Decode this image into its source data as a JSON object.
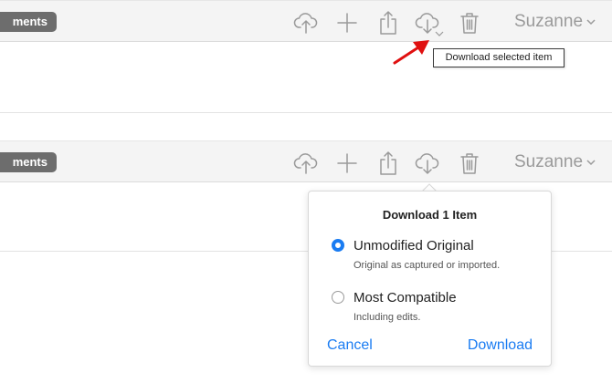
{
  "toolbar": {
    "pill_label": "ments",
    "user_name": "Suzanne",
    "icons": [
      "upload-cloud-icon",
      "plus-icon",
      "share-icon",
      "download-cloud-icon",
      "trash-icon",
      "chevron-down-icon"
    ]
  },
  "tooltip": {
    "text": "Download selected item"
  },
  "popover": {
    "title": "Download 1 Item",
    "options": [
      {
        "label": "Unmodified Original",
        "description": "Original as captured or imported.",
        "selected": true
      },
      {
        "label": "Most Compatible",
        "description": "Including edits.",
        "selected": false
      }
    ],
    "cancel_label": "Cancel",
    "download_label": "Download"
  },
  "colors": {
    "accent": "#1a7cf2",
    "annotation_arrow": "#e01010",
    "icon_gray": "#9a9a9a"
  }
}
